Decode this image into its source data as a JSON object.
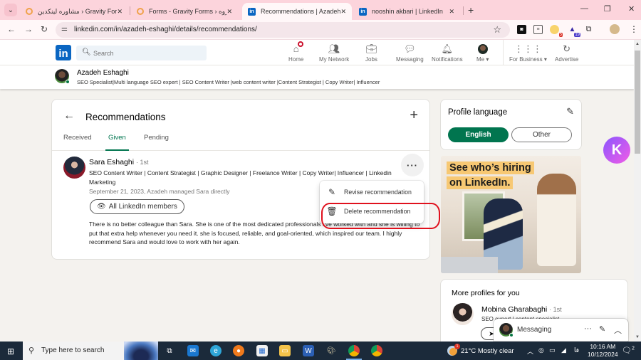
{
  "browser": {
    "tabs": [
      {
        "title": "مشاوره لینکدین › Gravity Forms",
        "favicon": "gravity-forms",
        "active": false
      },
      {
        "title": "Forms - Gravity Forms › ادمین گروه",
        "favicon": "gravity-forms",
        "active": false
      },
      {
        "title": "Recommendations | Azadeh Esh",
        "favicon": "linkedin",
        "active": true
      },
      {
        "title": "nooshin akbari | LinkedIn",
        "favicon": "linkedin",
        "active": false
      }
    ],
    "new_tab_icon": "+",
    "url": "linkedin.com/in/azadeh-eshaghi/details/recommendations/",
    "extension_badges": {
      "lightbulb": "5",
      "graduation": "19"
    }
  },
  "linkedin_nav": {
    "logo": "in",
    "search_placeholder": "Search",
    "items": [
      {
        "label": "Home",
        "icon": "home-icon"
      },
      {
        "label": "My Network",
        "icon": "network-icon"
      },
      {
        "label": "Jobs",
        "icon": "briefcase-icon"
      },
      {
        "label": "Messaging",
        "icon": "chat-icon"
      },
      {
        "label": "Notifications",
        "icon": "bell-icon"
      },
      {
        "label": "Me ▾",
        "icon": "avatar"
      },
      {
        "label": "For Business ▾",
        "icon": "grid-icon"
      },
      {
        "label": "Advertise",
        "icon": "advertise-icon"
      }
    ]
  },
  "profile_bar": {
    "name": "Azadeh Eshaghi",
    "headline": "SEO Specialist|Multi language SEO expert | SEO Content Writer |web content writer |Content Strategist | Copy Writer| Influencer"
  },
  "recommendations": {
    "title": "Recommendations",
    "tabs": [
      {
        "label": "Received",
        "active": false
      },
      {
        "label": "Given",
        "active": true
      },
      {
        "label": "Pending",
        "active": false
      }
    ],
    "items": [
      {
        "name": "Sara Eshaghi",
        "degree": "· 1st",
        "headline": "SEO Content Writer | Content Strategist | Graphic Designer | Freelance Writer | Copy Writer| Influencer | Linkedin Marketing",
        "date": "September 21, 2023, Azadeh managed Sara directly",
        "visibility": "All LinkedIn members",
        "text": "There is no better colleague than Sara. She is one of the most dedicated professionals I've worked with and she is willing to put that extra help whenever you need it. she is focused, reliable, and goal-oriented, which inspired our team. I highly recommend Sara and would love to work with her again."
      }
    ],
    "menu": [
      {
        "label": "Revise recommendation",
        "icon": "edit-icon"
      },
      {
        "label": "Delete recommendation",
        "icon": "trash-icon"
      }
    ]
  },
  "profile_language": {
    "title": "Profile language",
    "options": [
      {
        "label": "English",
        "selected": true
      },
      {
        "label": "Other",
        "selected": false
      }
    ]
  },
  "ad": {
    "line1": "See who’s hiring",
    "line2": "on LinkedIn."
  },
  "more_profiles": {
    "title": "More profiles for you",
    "items": [
      {
        "name": "Mobina Gharabaghi",
        "degree": "· 1st",
        "headline": "SEO expert | content specialist"
      }
    ]
  },
  "messaging": {
    "label": "Messaging"
  },
  "taskbar": {
    "search_placeholder": "Type here to search",
    "weather": "21°C  Mostly clear",
    "weather_badge": "1",
    "language": "فا",
    "time": "10:16 AM",
    "date": "10/12/2024",
    "notification_count": "2"
  },
  "colors": {
    "linkedin_blue": "#0a66c2",
    "linkedin_green": "#01754f",
    "highlight_red": "#e0111d",
    "tabstrip_pink": "#fcd4dc"
  }
}
